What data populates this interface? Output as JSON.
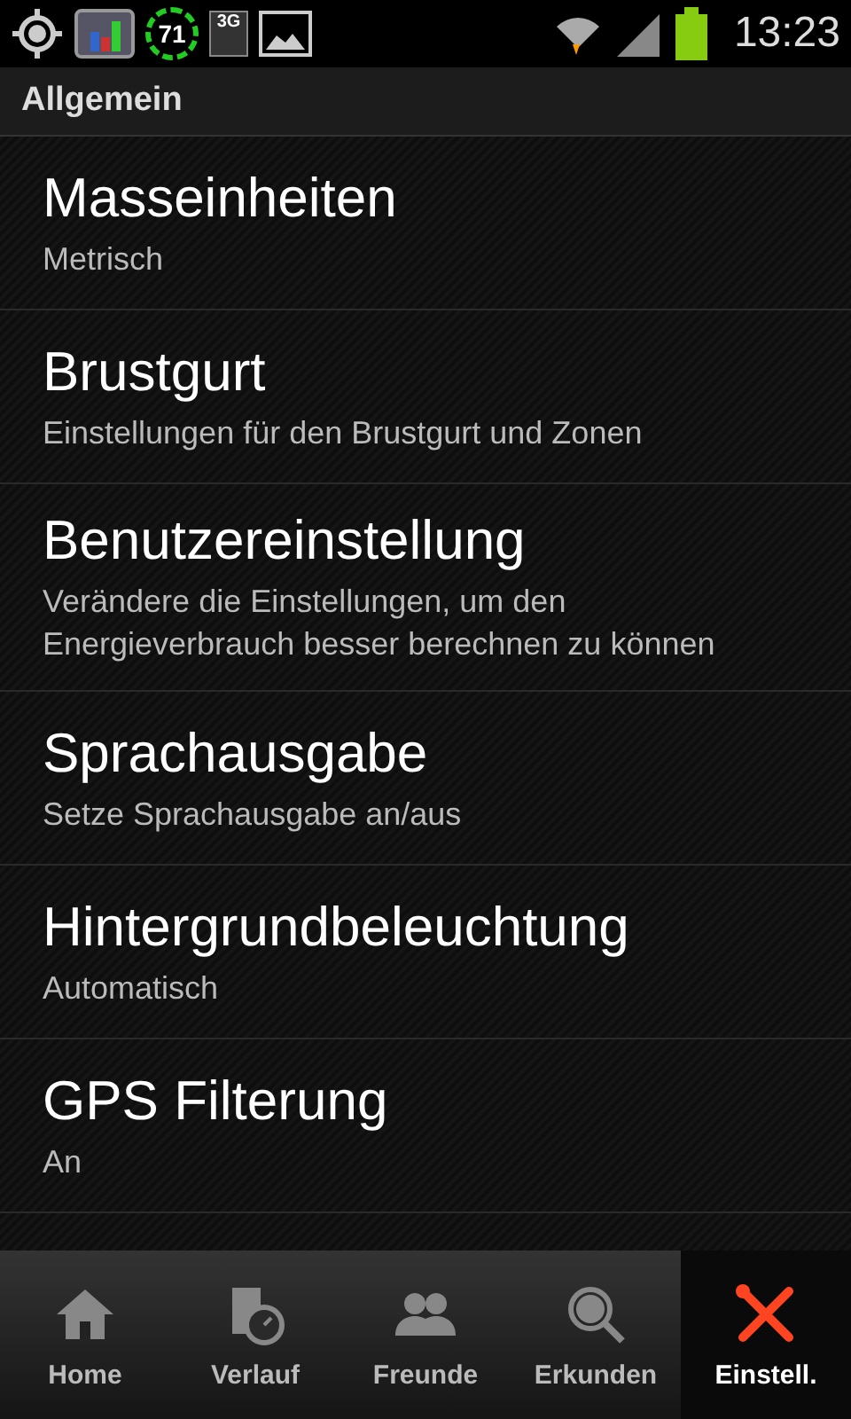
{
  "status_bar": {
    "badge_number": "71",
    "network_badge": "3G",
    "time": "13:23"
  },
  "section_header": "Allgemein",
  "settings": [
    {
      "title": "Masseinheiten",
      "summary": "Metrisch"
    },
    {
      "title": "Brustgurt",
      "summary": "Einstellungen für den Brustgurt und Zonen"
    },
    {
      "title": "Benutzereinstellung",
      "summary": "Verändere die Einstellungen, um den Energieverbrauch besser berechnen zu können"
    },
    {
      "title": "Sprachausgabe",
      "summary": "Setze Sprachausgabe an/aus"
    },
    {
      "title": "Hintergrundbeleuchtung",
      "summary": "Automatisch"
    },
    {
      "title": "GPS Filterung",
      "summary": "An"
    }
  ],
  "tabs": [
    {
      "kind": "home",
      "label": "Home",
      "selected": false
    },
    {
      "kind": "history",
      "label": "Verlauf",
      "selected": false
    },
    {
      "kind": "friends",
      "label": "Freunde",
      "selected": false
    },
    {
      "kind": "explore",
      "label": "Erkunden",
      "selected": false
    },
    {
      "kind": "settings",
      "label": "Einstell.",
      "selected": true
    }
  ]
}
